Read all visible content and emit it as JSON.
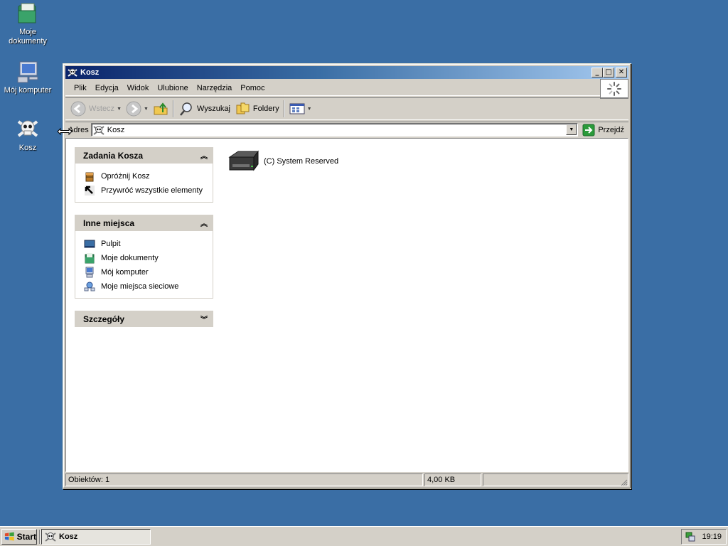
{
  "desktop": {
    "icons": [
      {
        "label_line1": "Moje",
        "label_line2": "dokumenty",
        "icon": "my-documents-icon"
      },
      {
        "label": "Mój komputer",
        "icon": "my-computer-icon"
      },
      {
        "label": "Kosz",
        "icon": "recycle-bin-icon"
      }
    ]
  },
  "window": {
    "title": "Kosz",
    "menu": [
      "Plik",
      "Edycja",
      "Widok",
      "Ulubione",
      "Narzędzia",
      "Pomoc"
    ],
    "toolbar": {
      "back_label": "Wstecz",
      "search_label": "Wyszukaj",
      "folders_label": "Foldery"
    },
    "address": {
      "label": "Adres",
      "value": "Kosz",
      "go_label": "Przejdź"
    },
    "panels": {
      "tasks": {
        "title": "Zadania Kosza",
        "items": [
          "Opróżnij Kosz",
          "Przywróć wszystkie elementy"
        ]
      },
      "places": {
        "title": "Inne miejsca",
        "items": [
          "Pulpit",
          "Moje dokumenty",
          "Mój komputer",
          "Moje miejsca sieciowe"
        ]
      },
      "details": {
        "title": "Szczegóły"
      }
    },
    "files": [
      {
        "name": "(C) System Reserved",
        "icon": "hard-drive-icon"
      }
    ],
    "status": {
      "objects": "Obiektów: 1",
      "size": "4,00 KB"
    }
  },
  "taskbar": {
    "start_label": "Start",
    "task_label": "Kosz",
    "clock": "19:19"
  }
}
